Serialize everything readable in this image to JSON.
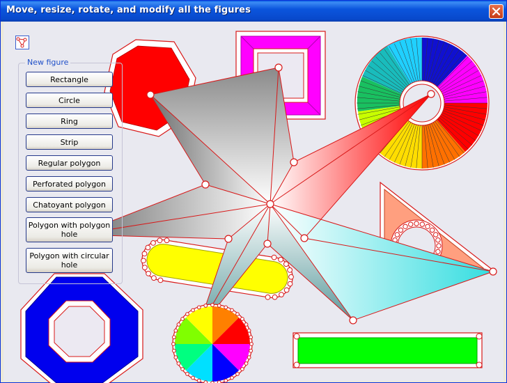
{
  "window": {
    "title": "Move, resize, rotate, and modify all the figures"
  },
  "toolbar": {
    "icon": "figure-nodes-icon"
  },
  "panel": {
    "legend": "New figure",
    "buttons": [
      "Rectangle",
      "Circle",
      "Ring",
      "Strip",
      "Regular polygon",
      "Perforated polygon",
      "Chatoyant polygon",
      "Polygon with polygon hole",
      "Polygon with circular hole"
    ]
  },
  "colors": {
    "titlebar": "#0b55dd",
    "client": "#e9e9f0",
    "outline": "#d81818",
    "heptagon": "#ff0000",
    "square_frame": "#ff00ff",
    "octagon_ring": "#0000ff",
    "strip": "#ffff00",
    "triangle": "#ff9f7f",
    "rectangle": "#00ff00",
    "star_center": "#ffffff"
  }
}
